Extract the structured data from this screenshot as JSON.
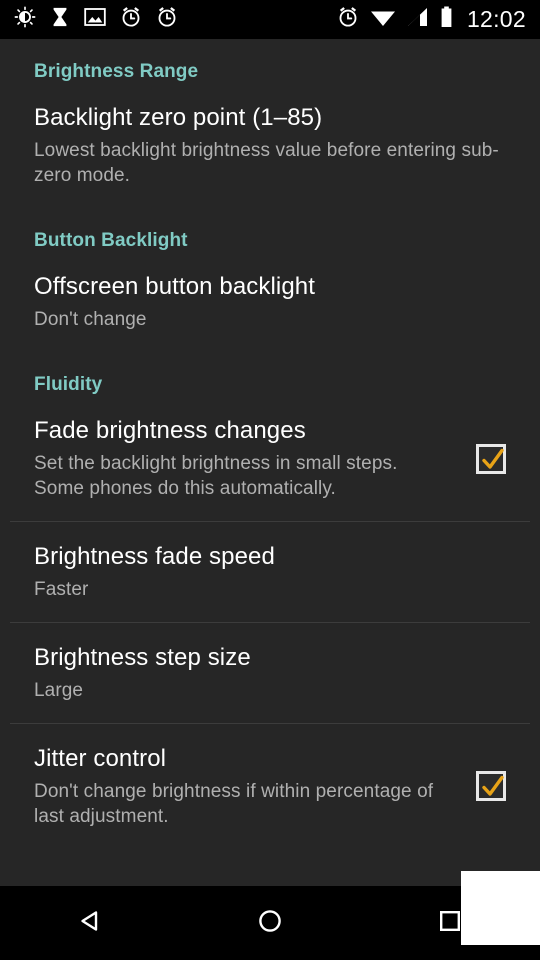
{
  "statusbar": {
    "time": "12:02",
    "left_icons": [
      {
        "name": "brightness-icon"
      },
      {
        "name": "hourglass-icon"
      },
      {
        "name": "image-icon"
      },
      {
        "name": "alarm-clock-icon"
      },
      {
        "name": "alarm-clock-icon"
      }
    ],
    "right_icons": [
      {
        "name": "alarm-clock-icon"
      },
      {
        "name": "wifi-icon"
      },
      {
        "name": "cell-signal-icon"
      },
      {
        "name": "battery-icon"
      }
    ]
  },
  "colors": {
    "accent_teal": "#80cbc4",
    "background": "#262626",
    "statusbar_bg": "#000000",
    "title_text": "#ffffff",
    "summary_text": "#b0b0b0",
    "divider": "#3c3c3c",
    "checkmark": "#e8a317",
    "checkbox_border": "#e8e8e8"
  },
  "sections": [
    {
      "header": "Brightness Range",
      "items": [
        {
          "title": "Backlight zero point (1–85)",
          "summary": "Lowest backlight brightness value before entering sub-zero mode.",
          "checkbox": null
        }
      ]
    },
    {
      "header": "Button Backlight",
      "items": [
        {
          "title": "Offscreen button backlight",
          "summary": "Don't change",
          "checkbox": null
        }
      ]
    },
    {
      "header": "Fluidity",
      "items": [
        {
          "title": "Fade brightness changes",
          "summary": "Set the backlight brightness in small steps. Some phones do this automatically.",
          "checkbox": "checked"
        },
        {
          "title": "Brightness fade speed",
          "summary": "Faster",
          "checkbox": null
        },
        {
          "title": "Brightness step size",
          "summary": "Large",
          "checkbox": null
        },
        {
          "title": "Jitter control",
          "summary": "Don't change brightness if within percentage of last adjustment.",
          "checkbox": "checked"
        }
      ]
    }
  ],
  "navbar": {
    "back_label": "Back",
    "home_label": "Home",
    "recents_label": "Recents"
  }
}
